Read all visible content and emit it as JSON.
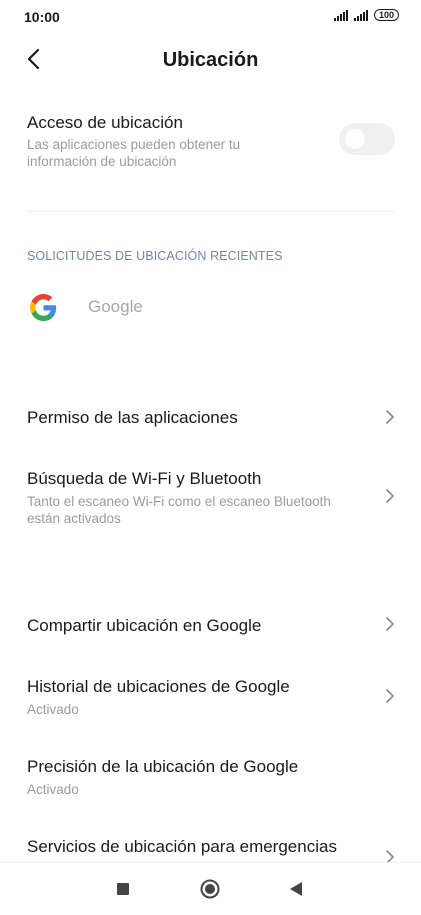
{
  "status_bar": {
    "time": "10:00",
    "battery": "100"
  },
  "header": {
    "title": "Ubicación"
  },
  "location_access": {
    "title": "Acceso de ubicación",
    "subtitle": "Las aplicaciones pueden obtener tu información de ubicación",
    "enabled": false
  },
  "recent_requests": {
    "header": "SOLICITUDES DE UBICACIÓN RECIENTES",
    "apps": [
      {
        "name": "Google",
        "icon": "google-logo-icon"
      }
    ]
  },
  "items": [
    {
      "title": "Permiso de las aplicaciones",
      "subtitle": ""
    },
    {
      "title": "Búsqueda de Wi-Fi y Bluetooth",
      "subtitle": "Tanto el escaneo Wi-Fi como el escaneo Bluetooth están activados"
    },
    {
      "title": "Compartir ubicación en Google",
      "subtitle": ""
    },
    {
      "title": "Historial de ubicaciones de Google",
      "subtitle": "Activado"
    },
    {
      "title": "Precisión de la ubicación de Google",
      "subtitle": "Activado"
    },
    {
      "title": "Servicios de ubicación para emergencias",
      "subtitle": ""
    }
  ],
  "colors": {
    "section_header": "#6e87a8",
    "subtitle": "#9b9b9b",
    "toggle_off": "#f0f0f0"
  }
}
